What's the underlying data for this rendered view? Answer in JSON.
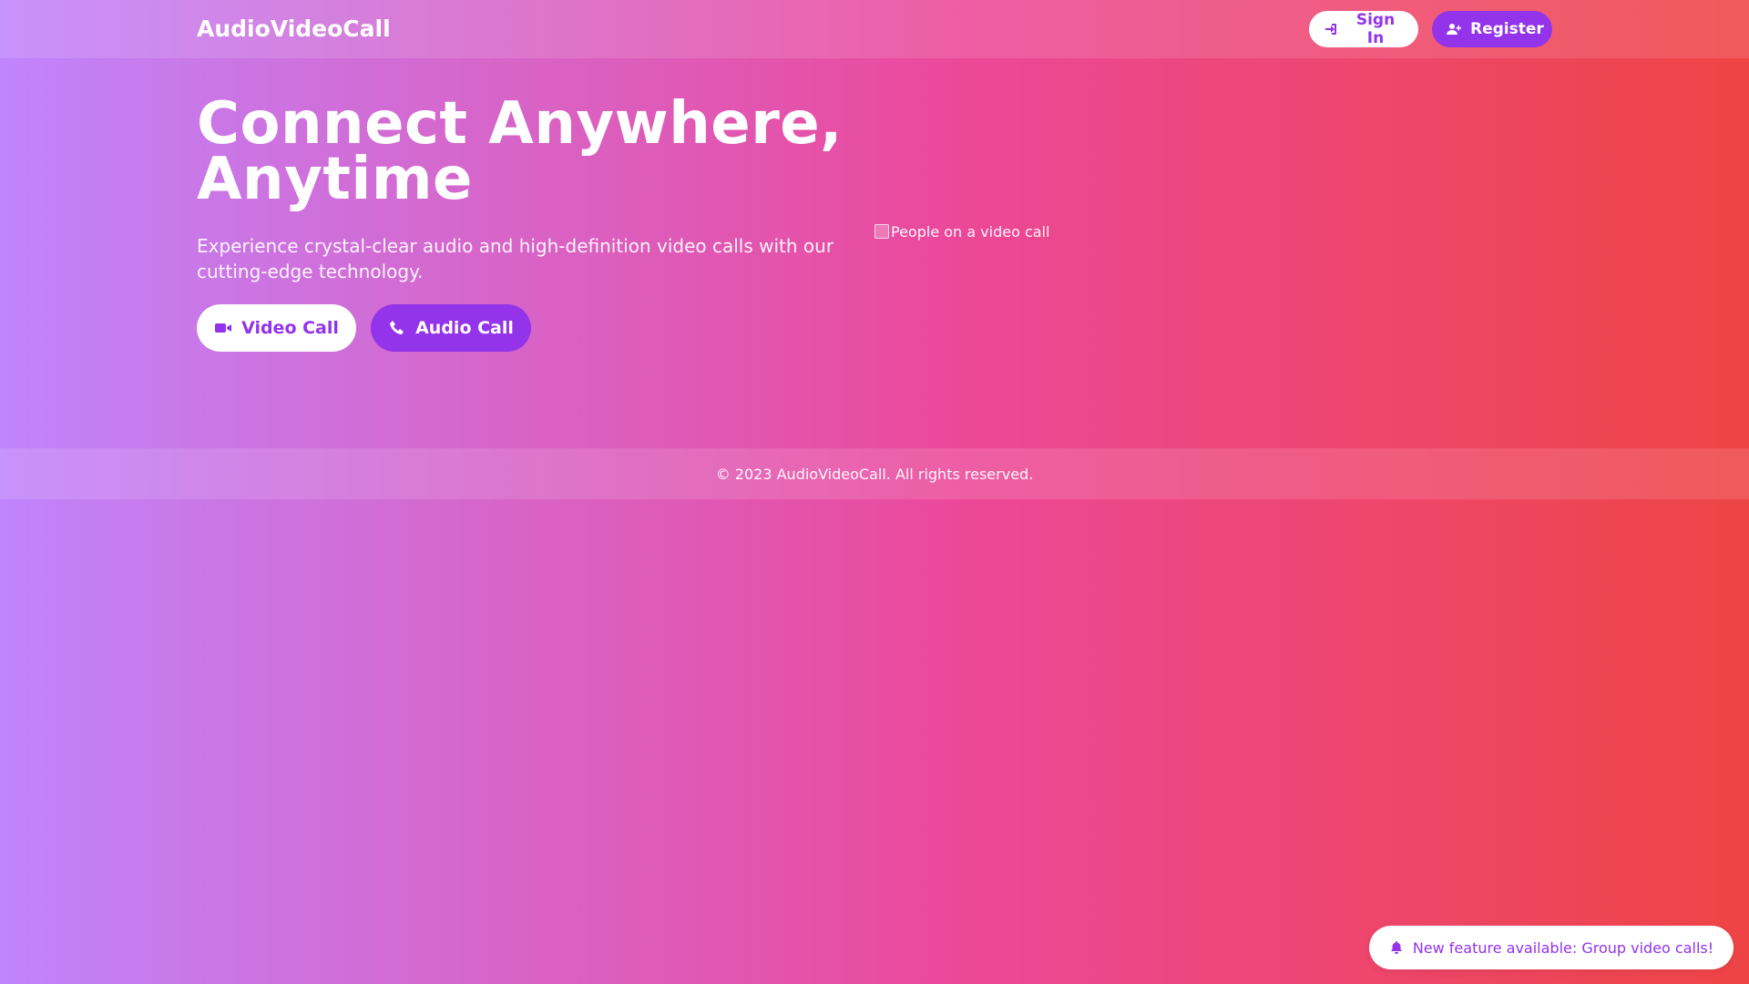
{
  "header": {
    "brand": "AudioVideoCall",
    "signin_label": "Sign In",
    "register_label": "Register",
    "signin_icon": "sign-in-icon",
    "register_icon": "user-plus-icon"
  },
  "hero": {
    "title": "Connect Anywhere, Anytime",
    "subtitle": "Experience crystal-clear audio and high-definition video calls with our cutting-edge technology.",
    "video_call_label": "Video Call",
    "audio_call_label": "Audio Call",
    "video_icon": "video-camera-icon",
    "audio_icon": "phone-icon",
    "image_alt": "People on a video call"
  },
  "footer": {
    "copyright": "© 2023 AudioVideoCall. All rights reserved."
  },
  "notification": {
    "text": "New feature available: Group video calls!",
    "icon": "bell-icon"
  },
  "colors": {
    "gradient_start": "#c084fc",
    "gradient_mid": "#ec4899",
    "gradient_end": "#ef4444",
    "accent": "#9333ea",
    "white": "#ffffff"
  }
}
